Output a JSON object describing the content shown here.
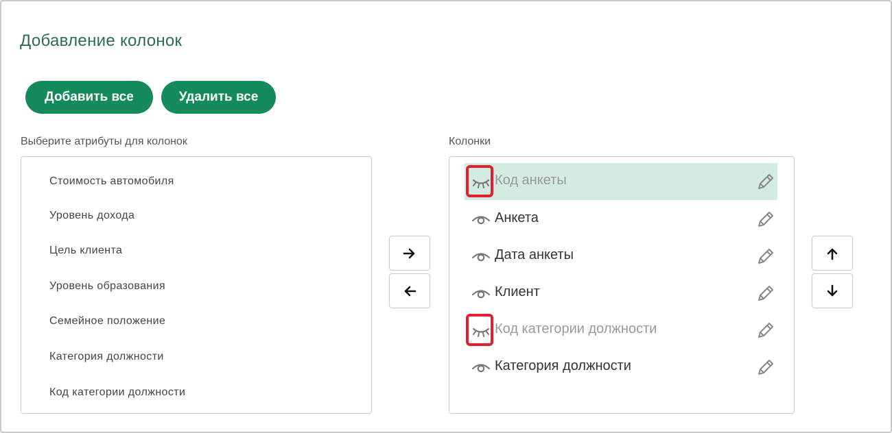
{
  "dialog": {
    "title": "Добавление колонок",
    "add_all_label": "Добавить все",
    "remove_all_label": "Удалить все"
  },
  "available": {
    "label": "Выберите атрибуты для колонок",
    "items": [
      "Стоимость автомобиля",
      "Уровень дохода",
      "Цель клиента",
      "Уровень образования",
      "Семейное положение",
      "Категория должности",
      "Код категории должности"
    ]
  },
  "columns": {
    "label": "Колонки",
    "items": [
      {
        "label": "Код анкеты",
        "visible": false,
        "selected": true
      },
      {
        "label": "Анкета",
        "visible": true,
        "selected": false
      },
      {
        "label": "Дата анкеты",
        "visible": true,
        "selected": false
      },
      {
        "label": "Клиент",
        "visible": true,
        "selected": false
      },
      {
        "label": "Код категории должности",
        "visible": false,
        "selected": false
      },
      {
        "label": "Категория должности",
        "visible": true,
        "selected": false
      }
    ]
  },
  "colors": {
    "accent": "#158a5c",
    "title": "#2e6b52",
    "selected_row": "#d3ebe1",
    "highlight": "#e0202e"
  }
}
